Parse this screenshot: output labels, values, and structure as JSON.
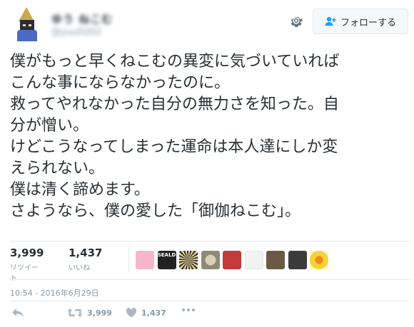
{
  "user": {
    "display_name": "ゆう ねこむ",
    "handle": "@yuu0202"
  },
  "follow_button": {
    "label": "フォローする"
  },
  "tweet": {
    "lines": [
      "僕がもっと早くねこむの異変に気づいていれば",
      "こんな事にならなかったのに。",
      "救ってやれなかった自分の無力さを知った。自",
      "分が憎い。",
      "けどこうなってしまった運命は本人達にしか変",
      "えられない。",
      "僕は清く諦めます。",
      "さようなら、僕の愛した「御伽ねこむ」。"
    ]
  },
  "stats": {
    "retweets": {
      "count": "3,999",
      "label": "リツイート"
    },
    "likes": {
      "count": "1,437",
      "label": "いいね"
    }
  },
  "likers": [
    {
      "icon": "pink-girl-avatar",
      "color": "#f4b6c8"
    },
    {
      "icon": "dark-logo-avatar",
      "color": "#222222",
      "text": "SEALD"
    },
    {
      "icon": "sunburst-avatar",
      "color": "#3a3226"
    },
    {
      "icon": "pattern-avatar",
      "color": "#8e8a7a"
    },
    {
      "icon": "anime-girl-avatar",
      "color": "#c23a3a"
    },
    {
      "icon": "text-avatar",
      "color": "#f2f2f2"
    },
    {
      "icon": "person-avatar",
      "color": "#6a5a44"
    },
    {
      "icon": "character-avatar",
      "color": "#3b3b3b"
    },
    {
      "icon": "flower-avatar",
      "color": "#f5d23a"
    }
  ],
  "timestamp": "10:54 - 2016年6月29日",
  "actions": {
    "retweet_count": "3,999",
    "like_count": "1,437"
  },
  "colors": {
    "text": "#292f33",
    "muted": "#8899a6",
    "border": "#e1e8ed",
    "accent": "#1da1f2"
  }
}
